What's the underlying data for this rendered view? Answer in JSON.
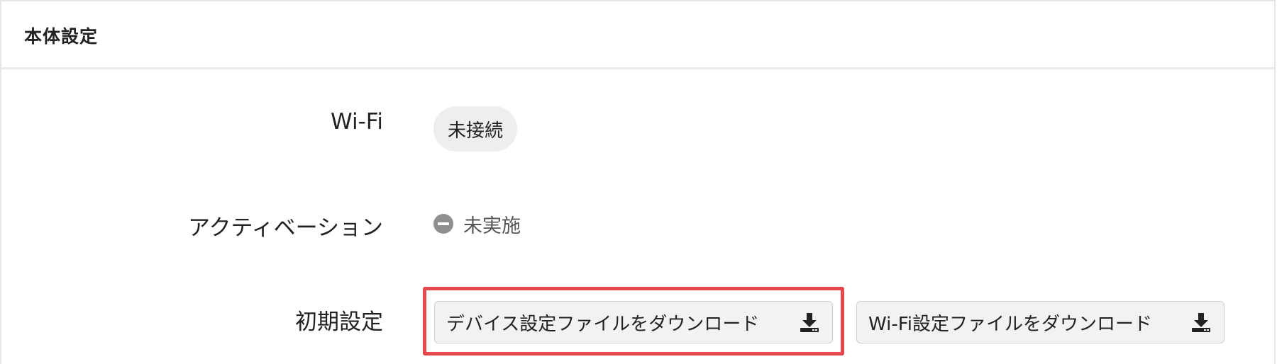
{
  "panel": {
    "title": "本体設定"
  },
  "rows": {
    "wifi": {
      "label": "Wi-Fi",
      "status": "未接続"
    },
    "activation": {
      "label": "アクティベーション",
      "status": "未実施",
      "icon": "minus-circle-icon"
    },
    "initial_setup": {
      "label": "初期設定",
      "device_button": "デバイス設定ファイルをダウンロード",
      "wifi_button": "Wi-Fi設定ファイルをダウンロード",
      "button_icon": "download-icon"
    }
  },
  "colors": {
    "highlight": "#e5484d",
    "chip_background": "#eeeeee",
    "button_background": "#f2f2f2",
    "status_icon": "#8f8f8f"
  }
}
